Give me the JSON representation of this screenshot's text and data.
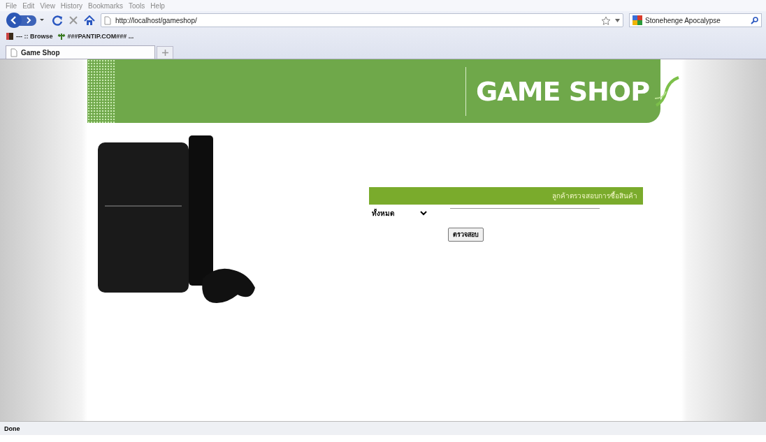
{
  "menu": [
    "File",
    "Edit",
    "View",
    "History",
    "Bookmarks",
    "Tools",
    "Help"
  ],
  "navigation": {
    "url": "http://localhost/gameshop/",
    "search": {
      "value": "Stonehenge Apocalypse"
    }
  },
  "bookmarks": [
    {
      "label": "--- :: Browse"
    },
    {
      "label": "###PANTIP.COM### ..."
    }
  ],
  "tabs": [
    {
      "label": "Game Shop",
      "selected": true
    }
  ],
  "page": {
    "banner": {
      "logo": "GAME SHOP"
    },
    "order_check": {
      "heading": "ลูกค้าตรวจสอบการซื้อสินค้า",
      "category": {
        "value": "ทั้งหมด"
      },
      "button": "ตรวจสอบ"
    }
  },
  "status_bar": "Done"
}
